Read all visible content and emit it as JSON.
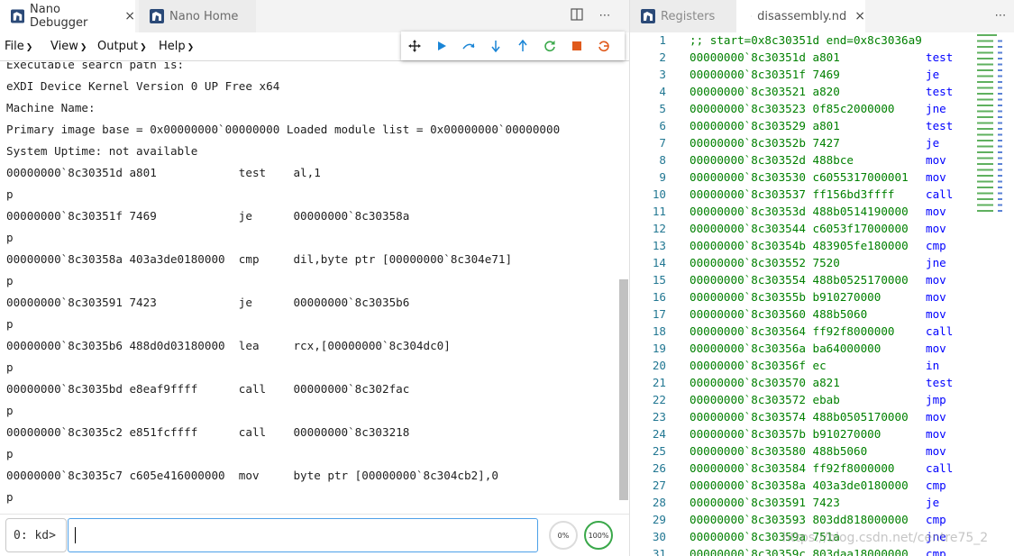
{
  "left_tabs": [
    {
      "label": "Nano Debugger",
      "icon": "nano-logo-icon",
      "close": "×"
    },
    {
      "label": "Nano Home",
      "icon": "nano-logo-icon"
    }
  ],
  "menu": [
    {
      "label": "File"
    },
    {
      "label": "View"
    },
    {
      "label": "Output"
    },
    {
      "label": "Help"
    }
  ],
  "debug_toolbar": [
    {
      "icon": "move-icon",
      "color": "#222222"
    },
    {
      "icon": "continue-icon",
      "color": "#1a85d6"
    },
    {
      "icon": "step-over-icon",
      "color": "#1a85d6"
    },
    {
      "icon": "step-into-icon",
      "color": "#1a85d6"
    },
    {
      "icon": "step-out-icon",
      "color": "#1a85d6"
    },
    {
      "icon": "restart-icon",
      "color": "#3aa84a"
    },
    {
      "icon": "stop-icon",
      "color": "#e05a1c"
    },
    {
      "icon": "disconnect-icon",
      "color": "#e05a1c"
    }
  ],
  "console_lines": [
    "Executable search path is:",
    "eXDI Device Kernel Version 0 UP Free x64",
    "Machine Name:",
    "Primary image base = 0x00000000`00000000 Loaded module list = 0x00000000`00000000",
    "System Uptime: not available",
    "00000000`8c30351d a801            test    al,1",
    "p",
    "00000000`8c30351f 7469            je      00000000`8c30358a",
    "p",
    "00000000`8c30358a 403a3de0180000  cmp     dil,byte ptr [00000000`8c304e71]",
    "p",
    "00000000`8c303591 7423            je      00000000`8c3035b6",
    "p",
    "00000000`8c3035b6 488d0d03180000  lea     rcx,[00000000`8c304dc0]",
    "p",
    "00000000`8c3035bd e8eaf9ffff      call    00000000`8c302fac",
    "p",
    "00000000`8c3035c2 e851fcffff      call    00000000`8c303218",
    "p",
    "00000000`8c3035c7 c605e416000000  mov     byte ptr [00000000`8c304cb2],0",
    "p"
  ],
  "prompt": "0: kd>",
  "input_value": "",
  "gauges": [
    {
      "label": "0%",
      "value": 0
    },
    {
      "label": "100%",
      "value": 100
    }
  ],
  "right_tabs": [
    {
      "label": "Registers",
      "icon": "nano-logo-icon"
    },
    {
      "label": "disassembly.nd",
      "icon": "file-lines-icon",
      "close": "×"
    }
  ],
  "disassembly_header": ";; start=0x8c30351d end=0x8c3036a9",
  "disassembly": [
    {
      "addr": "00000000`8c30351d",
      "bytes": "a801",
      "mnem": "test"
    },
    {
      "addr": "00000000`8c30351f",
      "bytes": "7469",
      "mnem": "je"
    },
    {
      "addr": "00000000`8c303521",
      "bytes": "a820",
      "mnem": "test"
    },
    {
      "addr": "00000000`8c303523",
      "bytes": "0f85c2000000",
      "mnem": "jne"
    },
    {
      "addr": "00000000`8c303529",
      "bytes": "a801",
      "mnem": "test"
    },
    {
      "addr": "00000000`8c30352b",
      "bytes": "7427",
      "mnem": "je"
    },
    {
      "addr": "00000000`8c30352d",
      "bytes": "488bce",
      "mnem": "mov"
    },
    {
      "addr": "00000000`8c303530",
      "bytes": "c6055317000001",
      "mnem": "mov"
    },
    {
      "addr": "00000000`8c303537",
      "bytes": "ff156bd3ffff",
      "mnem": "call"
    },
    {
      "addr": "00000000`8c30353d",
      "bytes": "488b0514190000",
      "mnem": "mov"
    },
    {
      "addr": "00000000`8c303544",
      "bytes": "c6053f17000000",
      "mnem": "mov"
    },
    {
      "addr": "00000000`8c30354b",
      "bytes": "483905fe180000",
      "mnem": "cmp"
    },
    {
      "addr": "00000000`8c303552",
      "bytes": "7520",
      "mnem": "jne"
    },
    {
      "addr": "00000000`8c303554",
      "bytes": "488b0525170000",
      "mnem": "mov"
    },
    {
      "addr": "00000000`8c30355b",
      "bytes": "b910270000",
      "mnem": "mov"
    },
    {
      "addr": "00000000`8c303560",
      "bytes": "488b5060",
      "mnem": "mov"
    },
    {
      "addr": "00000000`8c303564",
      "bytes": "ff92f8000000",
      "mnem": "call"
    },
    {
      "addr": "00000000`8c30356a",
      "bytes": "ba64000000",
      "mnem": "mov"
    },
    {
      "addr": "00000000`8c30356f",
      "bytes": "ec",
      "mnem": "in"
    },
    {
      "addr": "00000000`8c303570",
      "bytes": "a821",
      "mnem": "test"
    },
    {
      "addr": "00000000`8c303572",
      "bytes": "ebab",
      "mnem": "jmp"
    },
    {
      "addr": "00000000`8c303574",
      "bytes": "488b0505170000",
      "mnem": "mov"
    },
    {
      "addr": "00000000`8c30357b",
      "bytes": "b910270000",
      "mnem": "mov"
    },
    {
      "addr": "00000000`8c303580",
      "bytes": "488b5060",
      "mnem": "mov"
    },
    {
      "addr": "00000000`8c303584",
      "bytes": "ff92f8000000",
      "mnem": "call"
    },
    {
      "addr": "00000000`8c30358a",
      "bytes": "403a3de0180000",
      "mnem": "cmp"
    },
    {
      "addr": "00000000`8c303591",
      "bytes": "7423",
      "mnem": "je"
    },
    {
      "addr": "00000000`8c303593",
      "bytes": "803dd818000000",
      "mnem": "cmp"
    },
    {
      "addr": "00000000`8c30359a",
      "bytes": "751a",
      "mnem": "jne"
    },
    {
      "addr": "00000000`8c30359c",
      "bytes": "803daa18000000",
      "mnem": "cmp"
    }
  ],
  "watermark": "https://blog.csdn.net/centre75_2",
  "colors": {
    "accent": "#4da0e8",
    "address": "#008000",
    "mnemonic": "#0000ff",
    "line_number": "#237893"
  }
}
